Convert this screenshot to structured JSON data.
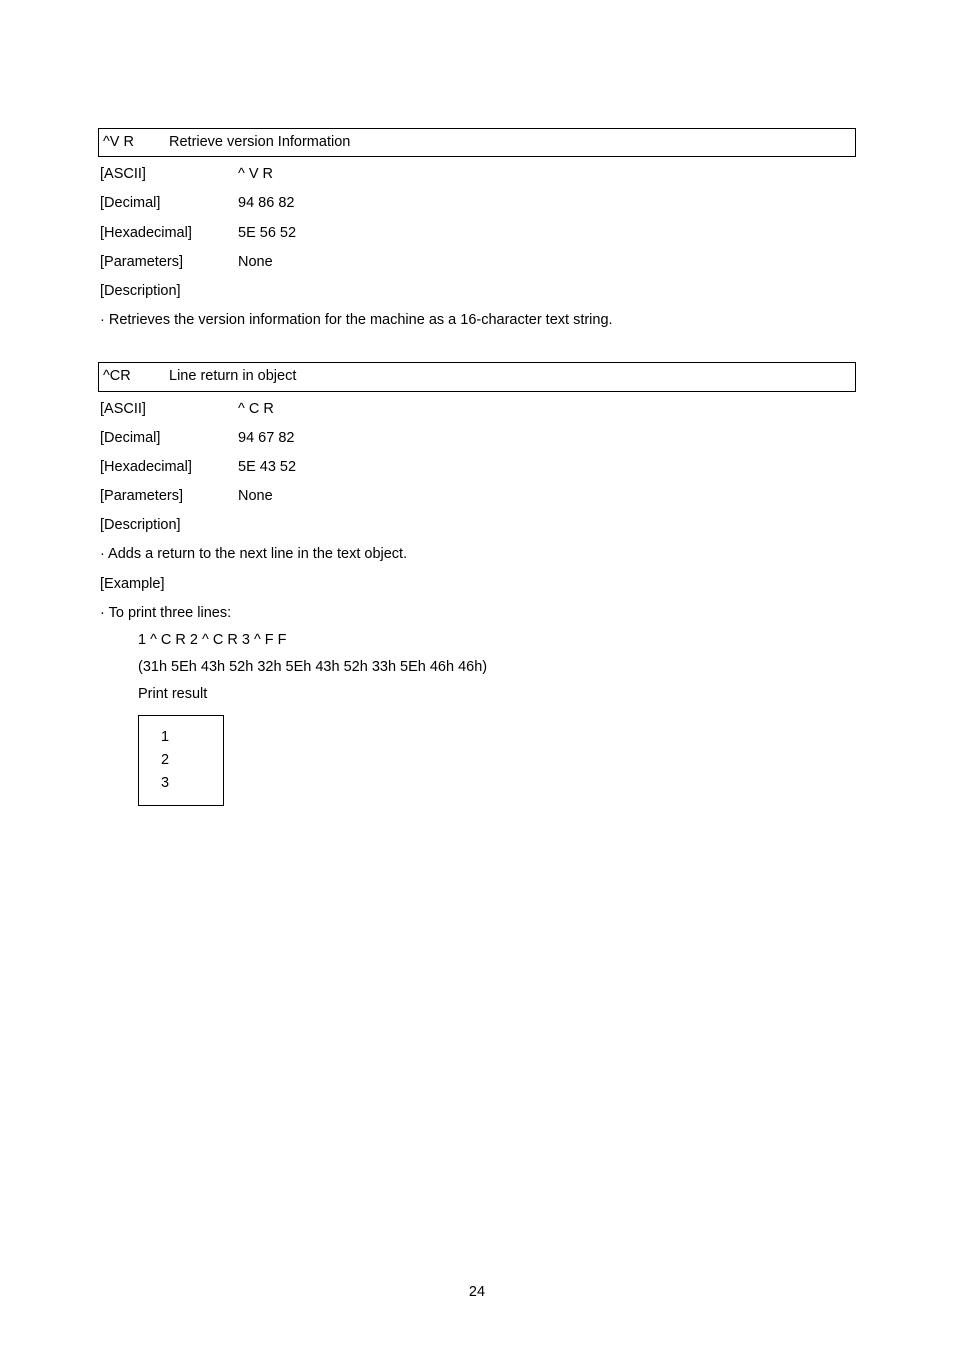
{
  "cmd1": {
    "code": "^V R",
    "title": "Retrieve version Information",
    "ascii_label": "[ASCII]",
    "ascii_value": "^ V R",
    "decimal_label": "[Decimal]",
    "decimal_value": "94 86 82",
    "hex_label": "[Hexadecimal]",
    "hex_value": "5E 56 52",
    "params_label": "[Parameters]",
    "params_value": "None",
    "desc_label": "[Description]",
    "desc_text": "· Retrieves the version information for the machine as a 16-character text string."
  },
  "cmd2": {
    "code": "^CR",
    "title": "Line return in object",
    "ascii_label": "[ASCII]",
    "ascii_value": "^ C R",
    "decimal_label": "[Decimal]",
    "decimal_value": "94 67 82",
    "hex_label": "[Hexadecimal]",
    "hex_value": "5E 43 52",
    "params_label": "[Parameters]",
    "params_value": "None",
    "desc_label": "[Description]",
    "desc_text": "· Adds a return to the next line in the text object.",
    "example_label": "[Example]",
    "example_intro": "· To print three lines:",
    "example_code": "1 ^ C R 2 ^ C R 3 ^ F F",
    "example_hex": "(31h 5Eh 43h 52h 32h 5Eh 43h 52h 33h 5Eh 46h 46h)",
    "print_result_label": "Print result",
    "print_result": [
      "1",
      "2",
      "3"
    ]
  },
  "page_number": "24"
}
